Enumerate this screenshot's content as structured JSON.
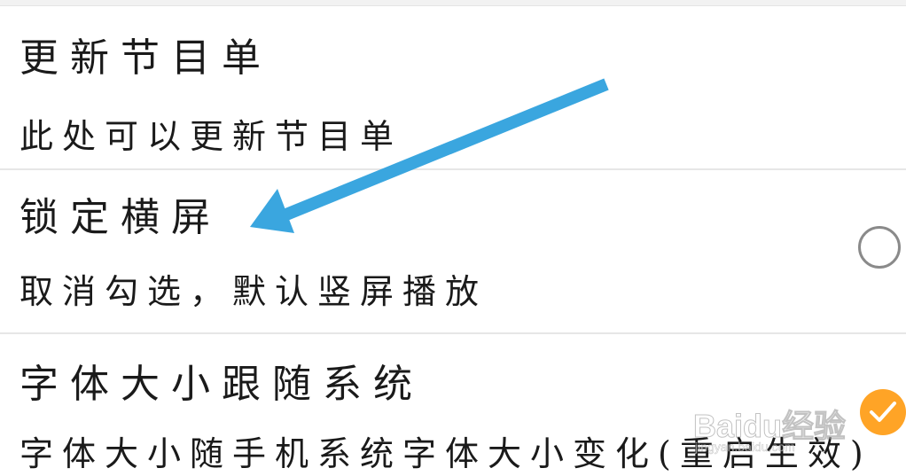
{
  "settings": {
    "items": [
      {
        "title": "更新节目单",
        "description": "此处可以更新节目单",
        "toggle": null
      },
      {
        "title": "锁定横屏",
        "description": "取消勾选，默认竖屏播放",
        "toggle": {
          "checked": false,
          "icon": "radio-unchecked-icon"
        }
      },
      {
        "title": "字体大小跟随系统",
        "description": "字体大小随手机系统字体大小变化(重启生效)",
        "toggle": {
          "checked": true,
          "icon": "checkmark-icon",
          "color": "#ffa426"
        }
      }
    ]
  },
  "annotation": {
    "arrow_color": "#3aa6df",
    "icon": "arrow-icon"
  },
  "watermark": {
    "logo": "Baidu经验",
    "url": "jingyan.baidu.com"
  }
}
